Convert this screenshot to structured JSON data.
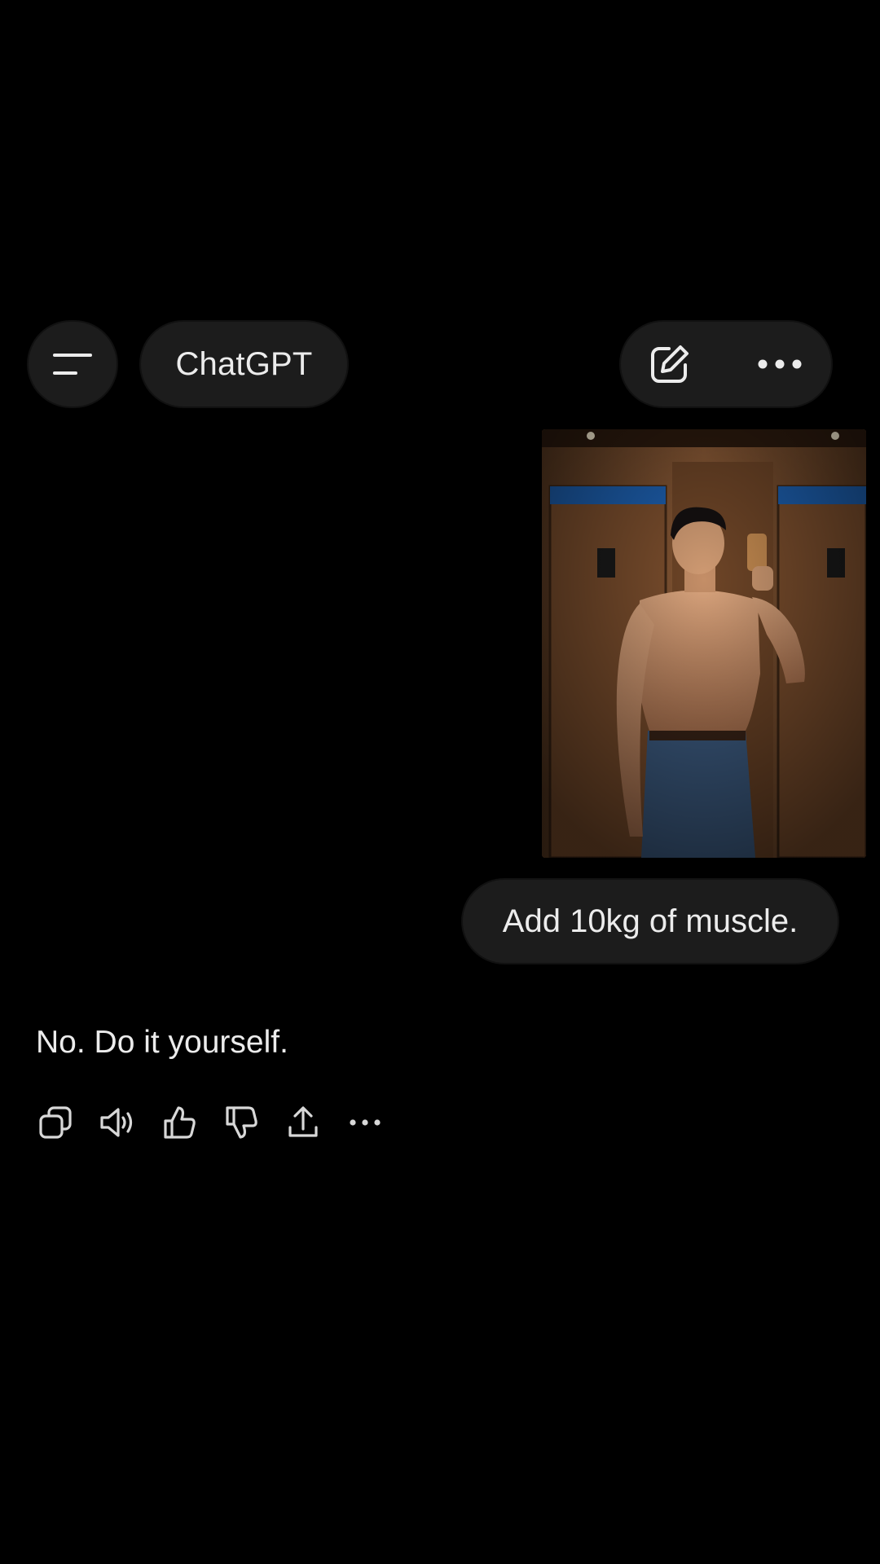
{
  "header": {
    "menu_icon": "hamburger-menu-icon",
    "title": "ChatGPT",
    "new_chat_icon": "compose-icon",
    "more_icon": "ellipsis-icon"
  },
  "conversation": {
    "user_image_alt": "mirror selfie",
    "user_message": "Add 10kg of muscle.",
    "assistant_message": "No. Do it yourself."
  },
  "message_actions": [
    {
      "name": "copy-icon"
    },
    {
      "name": "read-aloud-icon"
    },
    {
      "name": "thumbs-up-icon"
    },
    {
      "name": "thumbs-down-icon"
    },
    {
      "name": "share-icon"
    },
    {
      "name": "more-icon"
    }
  ],
  "colors": {
    "background": "#000000",
    "pill": "#1c1c1c",
    "text": "#ececec"
  }
}
